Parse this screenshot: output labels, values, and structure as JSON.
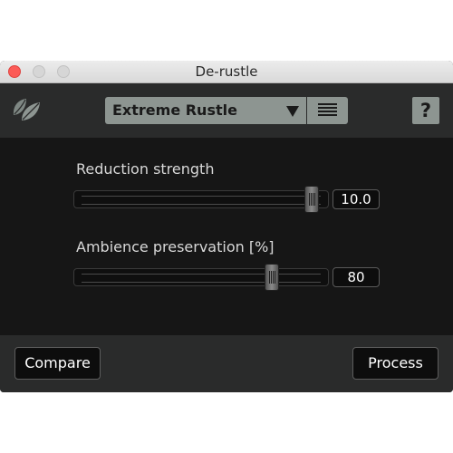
{
  "window": {
    "title": "De-rustle"
  },
  "toolbar": {
    "logo_icon": "leaf-icon",
    "preset": {
      "selected": "Extreme Rustle",
      "dropdown_icon": "chevron-down-icon",
      "list_icon": "hamburger-list-icon"
    },
    "help_label": "?"
  },
  "controls": {
    "reduction": {
      "label": "Reduction strength",
      "value": "10.0",
      "fraction": 0.97
    },
    "ambience": {
      "label": "Ambience preservation [%]",
      "value": "80",
      "fraction": 0.8
    }
  },
  "footer": {
    "compare_label": "Compare",
    "process_label": "Process"
  },
  "colors": {
    "background": "#161616",
    "toolbar": "#2a2b2b",
    "control_gray": "#8d9591",
    "close": "#fc5b57"
  }
}
